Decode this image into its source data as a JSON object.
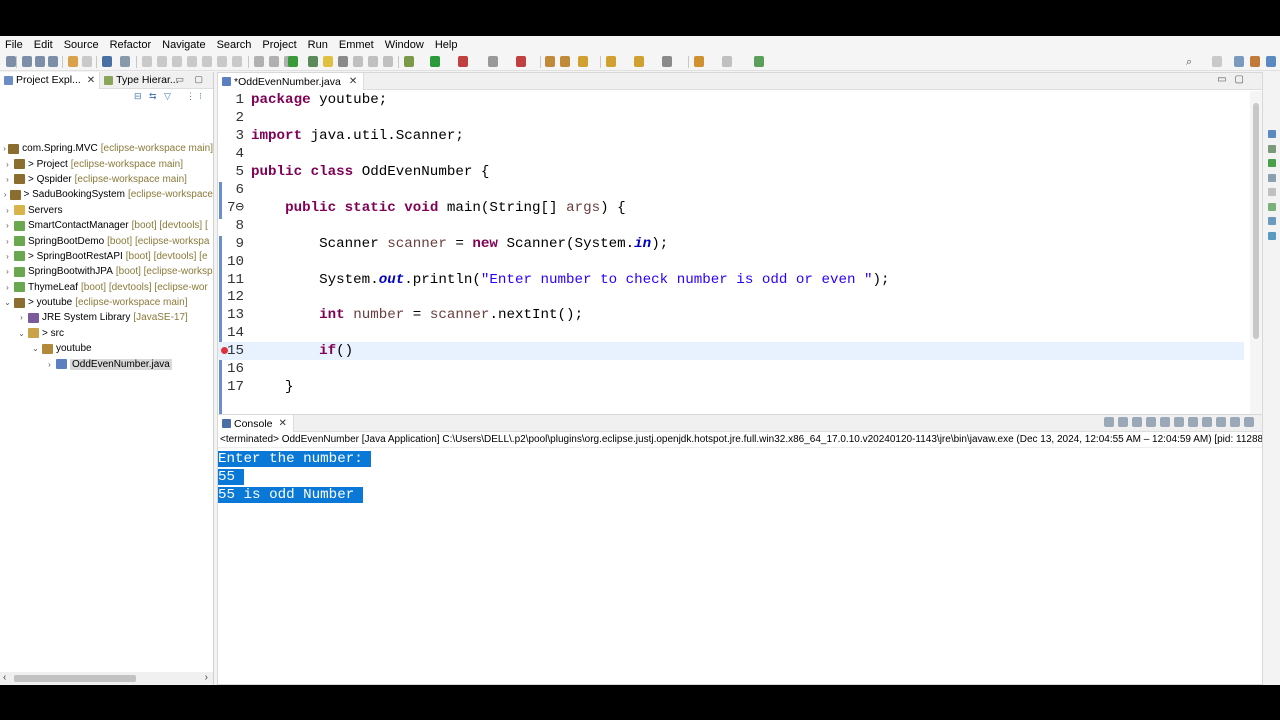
{
  "menu": [
    "File",
    "Edit",
    "Source",
    "Refactor",
    "Navigate",
    "Search",
    "Project",
    "Run",
    "Emmet",
    "Window",
    "Help"
  ],
  "left_panel": {
    "tabs": [
      {
        "label": "Project Expl...",
        "close": "✕"
      },
      {
        "label": "Type Hierar...",
        "close": ""
      }
    ],
    "tree": [
      {
        "indent": 0,
        "arrow": "›",
        "name": "com.Spring.MVC",
        "deco": "[eclipse-workspace main]",
        "color": "#8b6d2f"
      },
      {
        "indent": 0,
        "arrow": "›",
        "name": "> Project",
        "deco": "[eclipse-workspace main]",
        "color": "#8b6d2f"
      },
      {
        "indent": 0,
        "arrow": "›",
        "name": "> Qspider",
        "deco": "[eclipse-workspace main]",
        "color": "#8b6d2f"
      },
      {
        "indent": 0,
        "arrow": "›",
        "name": "> SaduBookingSystem",
        "deco": "[eclipse-workspace",
        "color": "#8b6d2f"
      },
      {
        "indent": 0,
        "arrow": "›",
        "name": "Servers",
        "deco": "",
        "color": "#d9b44a"
      },
      {
        "indent": 0,
        "arrow": "›",
        "name": "SmartContactManager",
        "deco": "[boot] [devtools] [",
        "color": "#6aa84f"
      },
      {
        "indent": 0,
        "arrow": "›",
        "name": "SpringBootDemo",
        "deco": "[boot] [eclipse-workspa",
        "color": "#6aa84f"
      },
      {
        "indent": 0,
        "arrow": "›",
        "name": "> SpringBootRestAPI",
        "deco": "[boot] [devtools] [e",
        "color": "#6aa84f"
      },
      {
        "indent": 0,
        "arrow": "›",
        "name": "SpringBootwithJPA",
        "deco": "[boot] [eclipse-worksp",
        "color": "#6aa84f"
      },
      {
        "indent": 0,
        "arrow": "›",
        "name": "ThymeLeaf",
        "deco": "[boot] [devtools] [eclipse-wor",
        "color": "#6aa84f"
      },
      {
        "indent": 0,
        "arrow": "⌄",
        "name": "> youtube",
        "deco": "[eclipse-workspace main]",
        "color": "#8b6d2f"
      },
      {
        "indent": 1,
        "arrow": "›",
        "name": "JRE System Library",
        "deco": "[JavaSE-17]",
        "color": "#7a5a9a"
      },
      {
        "indent": 1,
        "arrow": "⌄",
        "name": "> src",
        "deco": "",
        "color": "#c9a24a"
      },
      {
        "indent": 2,
        "arrow": "⌄",
        "name": "youtube",
        "deco": "",
        "color": "#b08a3a"
      },
      {
        "indent": 3,
        "arrow": "›",
        "name": "OddEvenNumber.java",
        "deco": "",
        "color": "#5b7fc0",
        "selected": true
      }
    ]
  },
  "editor": {
    "tab_label": "*OddEvenNumber.java",
    "tab_close": "✕",
    "lines": [
      {
        "n": "1",
        "tokens": [
          {
            "t": "package",
            "c": "kw"
          },
          {
            "t": " youtube;",
            "c": ""
          }
        ]
      },
      {
        "n": "2",
        "tokens": []
      },
      {
        "n": "3",
        "tokens": [
          {
            "t": "import",
            "c": "kw"
          },
          {
            "t": " java.util.Scanner;",
            "c": ""
          }
        ]
      },
      {
        "n": "4",
        "tokens": []
      },
      {
        "n": "5",
        "tokens": [
          {
            "t": "public",
            "c": "kw"
          },
          {
            "t": " ",
            "c": ""
          },
          {
            "t": "class",
            "c": "kw"
          },
          {
            "t": " OddEvenNumber {",
            "c": ""
          }
        ]
      },
      {
        "n": "6",
        "tokens": []
      },
      {
        "n": "7⊖",
        "tokens": [
          {
            "t": "    ",
            "c": ""
          },
          {
            "t": "public",
            "c": "kw"
          },
          {
            "t": " ",
            "c": ""
          },
          {
            "t": "static",
            "c": "kw"
          },
          {
            "t": " ",
            "c": ""
          },
          {
            "t": "void",
            "c": "kw"
          },
          {
            "t": " main(String[] ",
            "c": ""
          },
          {
            "t": "args",
            "c": "var"
          },
          {
            "t": ") {",
            "c": ""
          }
        ]
      },
      {
        "n": "8",
        "tokens": []
      },
      {
        "n": "9",
        "tokens": [
          {
            "t": "        Scanner ",
            "c": ""
          },
          {
            "t": "scanner",
            "c": "var"
          },
          {
            "t": " = ",
            "c": ""
          },
          {
            "t": "new",
            "c": "kw"
          },
          {
            "t": " Scanner(System.",
            "c": ""
          },
          {
            "t": "in",
            "c": "fld"
          },
          {
            "t": ");",
            "c": ""
          }
        ]
      },
      {
        "n": "10",
        "tokens": []
      },
      {
        "n": "11",
        "tokens": [
          {
            "t": "        System.",
            "c": ""
          },
          {
            "t": "out",
            "c": "fld"
          },
          {
            "t": ".println(",
            "c": ""
          },
          {
            "t": "\"Enter number to check number is odd or even \"",
            "c": "str"
          },
          {
            "t": ");",
            "c": ""
          }
        ]
      },
      {
        "n": "12",
        "tokens": []
      },
      {
        "n": "13",
        "tokens": [
          {
            "t": "        ",
            "c": ""
          },
          {
            "t": "int",
            "c": "kw"
          },
          {
            "t": " ",
            "c": ""
          },
          {
            "t": "number",
            "c": "var"
          },
          {
            "t": " = ",
            "c": ""
          },
          {
            "t": "scanner",
            "c": "var"
          },
          {
            "t": ".nextInt();",
            "c": ""
          }
        ]
      },
      {
        "n": "14",
        "tokens": []
      },
      {
        "n": "15",
        "tokens": [
          {
            "t": "        ",
            "c": ""
          },
          {
            "t": "if",
            "c": "kw"
          },
          {
            "t": "()",
            "c": ""
          }
        ],
        "current": true,
        "error": true
      },
      {
        "n": "16",
        "tokens": []
      },
      {
        "n": "17",
        "tokens": [
          {
            "t": "    }",
            "c": ""
          }
        ]
      }
    ]
  },
  "console": {
    "tab_label": "Console",
    "tab_close": "✕",
    "status": "<terminated> OddEvenNumber [Java Application] C:\\Users\\DELL\\.p2\\pool\\plugins\\org.eclipse.justj.openjdk.hotspot.jre.full.win32.x86_64_17.0.10.v20240120-1143\\jre\\bin\\javaw.exe  (Dec 13, 2024, 12:04:55 AM – 12:04:59 AM) [pid: 11288]",
    "output": [
      "Enter the number: ",
      "55 ",
      "55 is odd Number "
    ]
  },
  "colors": {
    "keyword": "#7f0055",
    "string": "#2a00ff",
    "field": "#0000c0",
    "selection": "#0a78d7",
    "current_line": "#e8f2fe"
  }
}
